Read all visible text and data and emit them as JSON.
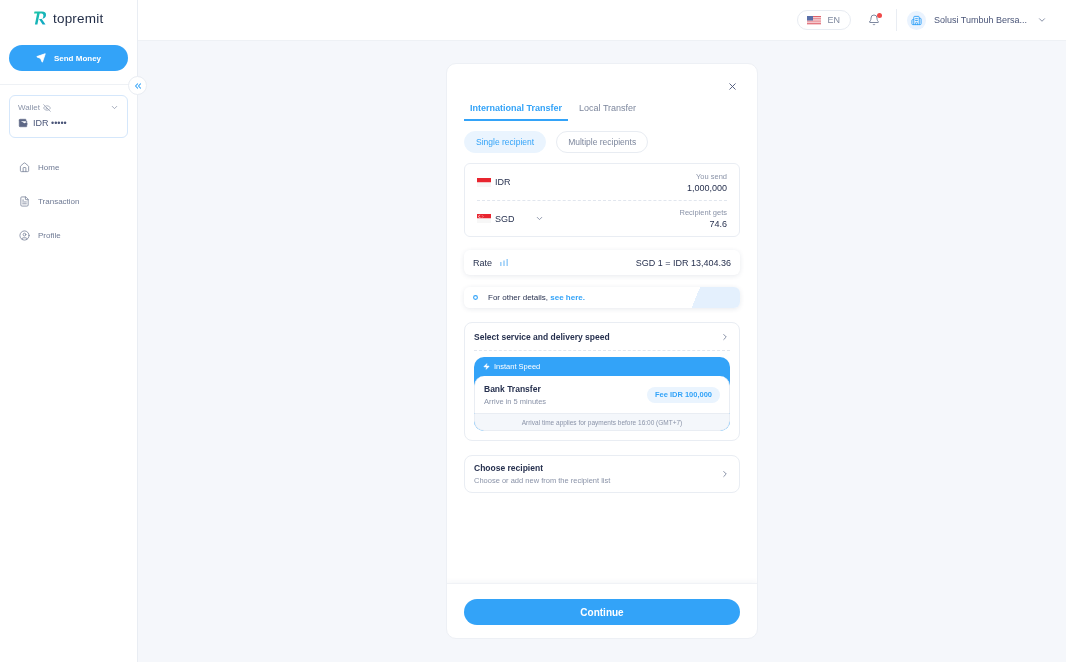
{
  "brand": {
    "name": "topremit"
  },
  "sidebar": {
    "send_button": "Send Money",
    "wallet": {
      "label": "Wallet",
      "balance_hidden": true,
      "balance": "IDR •••••"
    },
    "nav_items": [
      {
        "label": "Home",
        "selected": false
      },
      {
        "label": "Transaction",
        "selected": false
      },
      {
        "label": "Profile",
        "selected": false
      }
    ]
  },
  "header": {
    "language": "EN",
    "has_notification": true,
    "account_name": "Solusi Tumbuh Bersa..."
  },
  "transfer": {
    "tabs": [
      {
        "label": "International Transfer",
        "selected": true
      },
      {
        "label": "Local Transfer",
        "selected": false
      }
    ],
    "recipient_modes": [
      {
        "label": "Single recipient",
        "selected": true
      },
      {
        "label": "Multiple recipients",
        "selected": false
      }
    ],
    "amounts": [
      {
        "currency": "IDR",
        "dropdown": false,
        "label": "You send",
        "value": "1,000,000"
      },
      {
        "currency": "SGD",
        "dropdown": true,
        "label": "Recipient gets",
        "value": "74.6"
      }
    ],
    "rate": {
      "label": "Rate",
      "value": "SGD 1 = IDR 13,404.36"
    },
    "notice": {
      "text": "For other details,",
      "link": "see here."
    },
    "service": {
      "title": "Select service and delivery speed",
      "speed": "Instant Speed",
      "method": "Bank Transfer",
      "eta": "Arrive in 5 minutes",
      "fee": "Fee IDR 100,000",
      "note": "Arrival time applies for payments before 16:00 (GMT+7)"
    },
    "recipient": {
      "title": "Choose recipient",
      "subtitle": "Choose or add new from the recipient list"
    },
    "continue_button": "Continue"
  }
}
